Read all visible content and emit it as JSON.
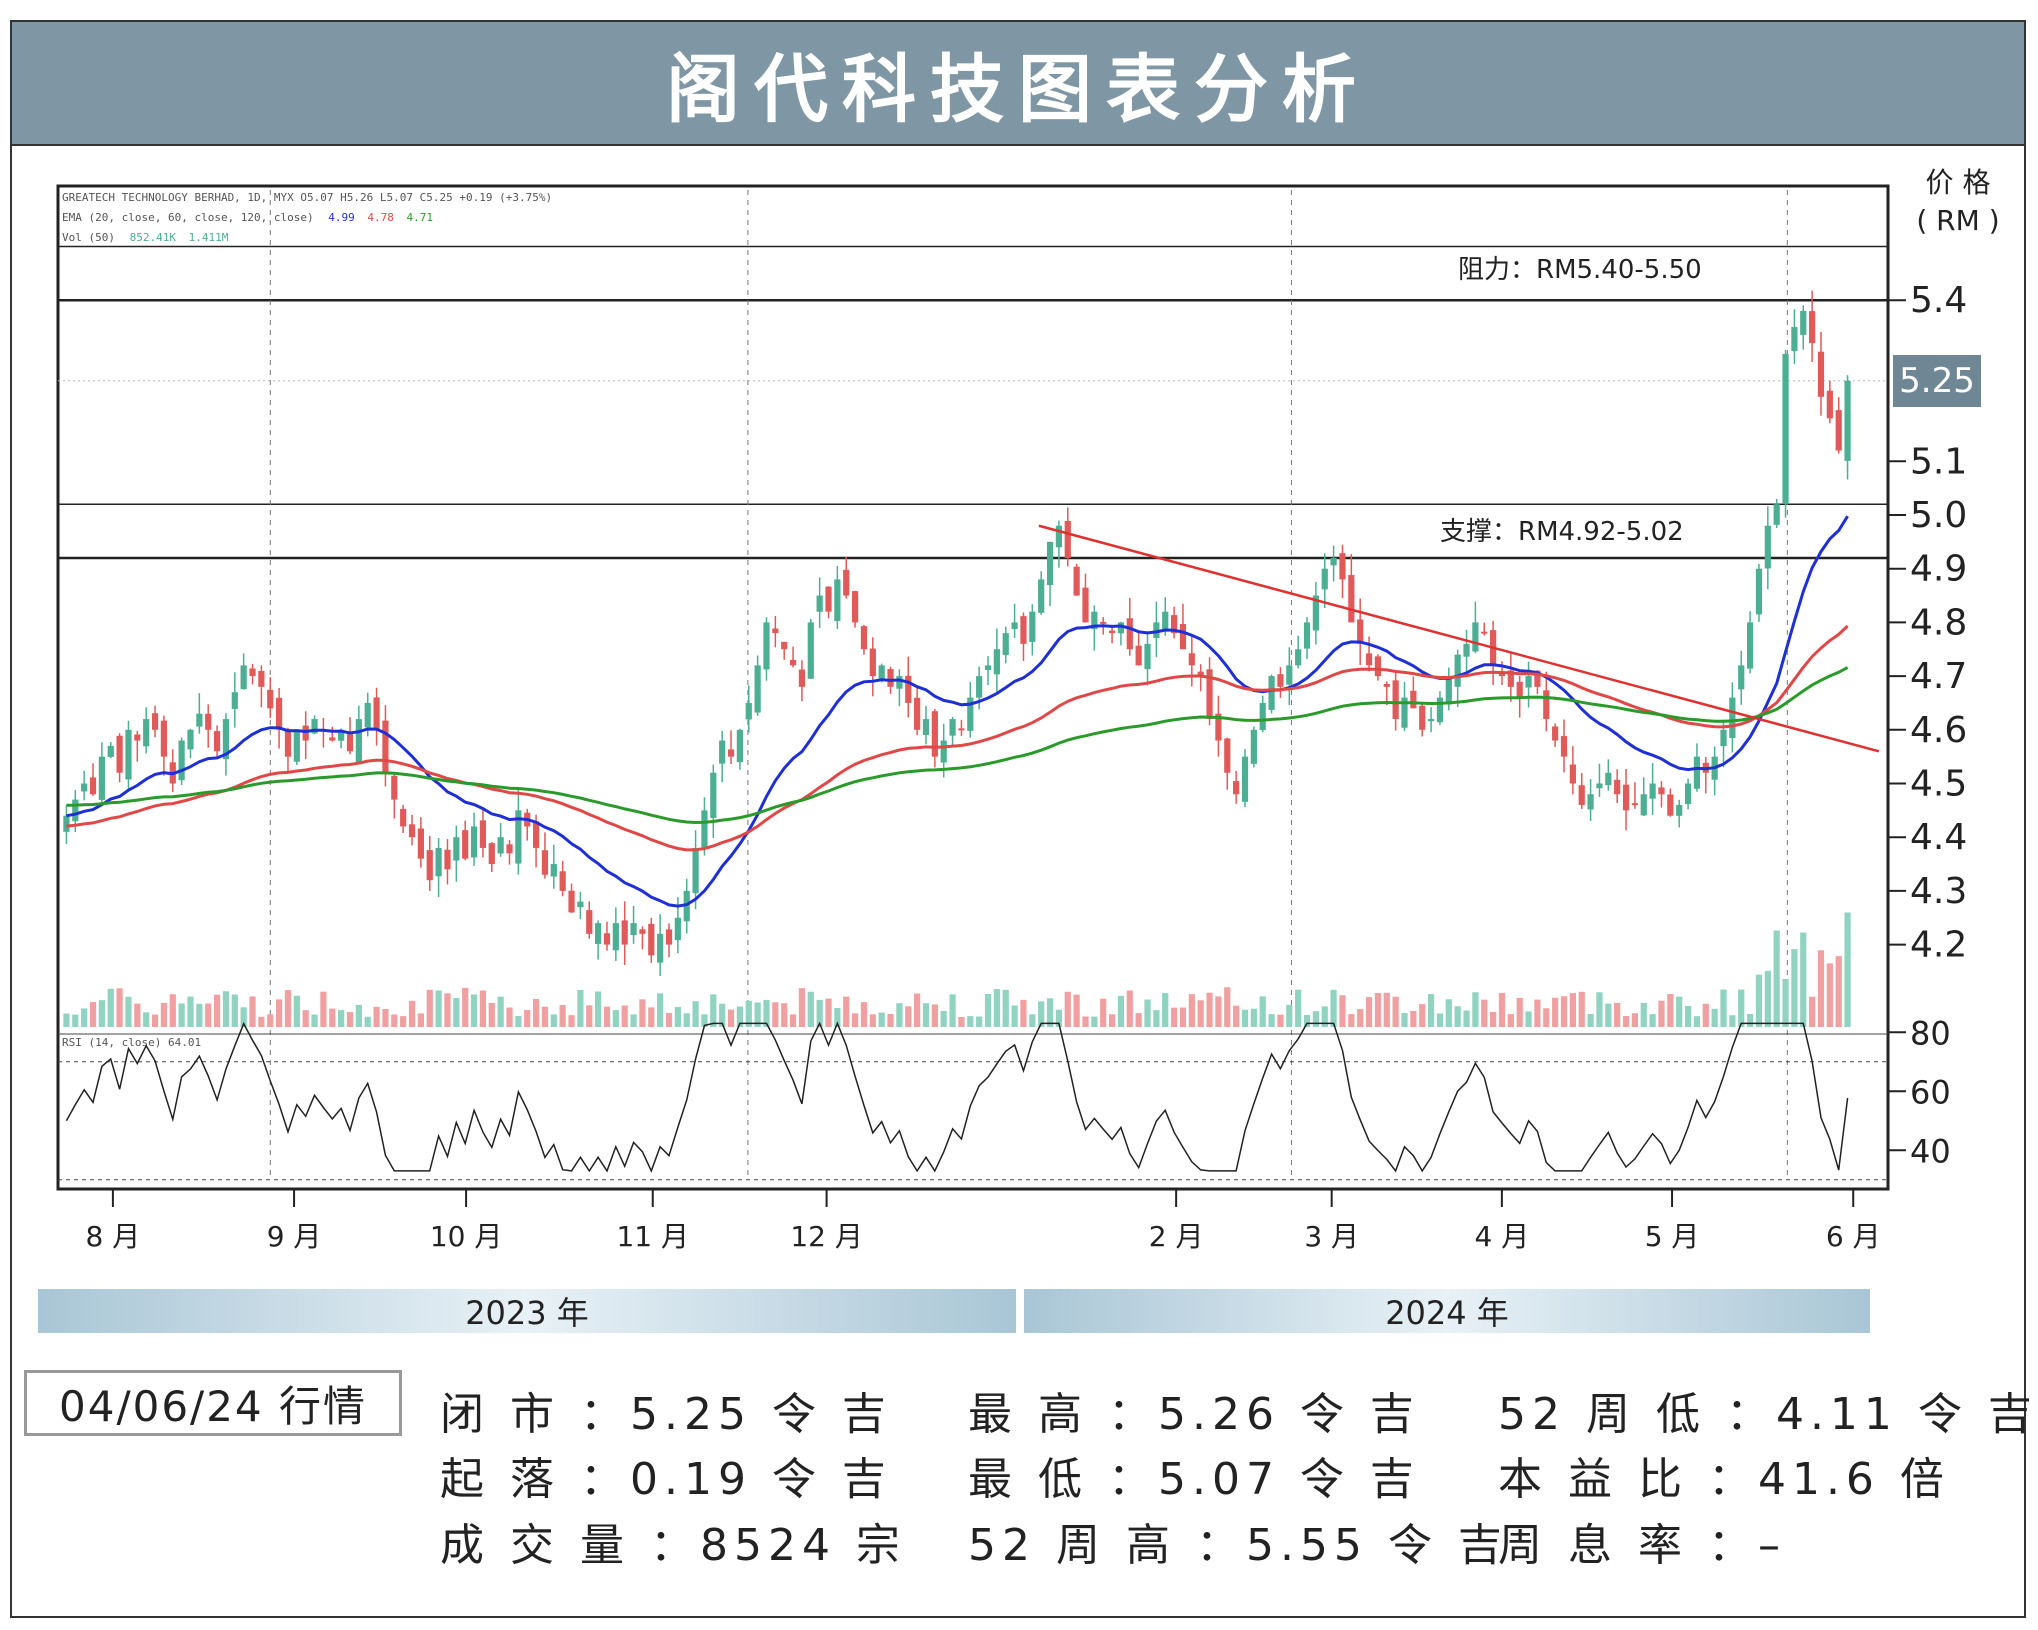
{
  "title": "阁代科技图表分析",
  "unit_label_1": "价 格",
  "unit_label_2": "( RM )",
  "chart_header": {
    "line1": "GREATECH TECHNOLOGY BERHAD, 1D, MYX  O5.07  H5.26  L5.07  C5.25  +0.19 (+3.75%)",
    "line2_prefix": "EMA (20, close, 60, close, 120, close)",
    "ema_values": [
      "4.99",
      "4.78",
      "4.71"
    ],
    "line3_prefix": "Vol (50)",
    "vol_values": [
      "852.41K",
      "1.411M"
    ]
  },
  "rsi_label": "RSI (14, close)  64.01",
  "current_price_tag": "5.25",
  "resistance_label": "阻力：RM5.40-5.50",
  "support_label": "支撑：RM4.92-5.02",
  "y_ticks": [
    "5.4",
    "5.1",
    "5.0",
    "4.9",
    "4.8",
    "4.7",
    "4.6",
    "4.5",
    "4.4",
    "4.3",
    "4.2"
  ],
  "rsi_ticks": [
    "80",
    "60",
    "40"
  ],
  "x_ticks": [
    "8 月",
    "9 月",
    "10 月",
    "11 月",
    "12 月",
    "2 月",
    "3 月",
    "4 月",
    "5 月",
    "6 月"
  ],
  "years": [
    "2023 年",
    "2024 年"
  ],
  "date_box": "04/06/24 行情",
  "stats": {
    "close": "闭 市 ：5.25 令 吉",
    "change": "起 落 ：0.19 令 吉",
    "volume": "成 交 量 ：8524 宗",
    "high": "最 高 ：5.26 令 吉",
    "low": "最 低 ：5.07 令 吉",
    "high52": "52 周 高 ：5.55 令 吉",
    "low52": "52 周 低 ：4.11 令 吉",
    "pe": "本 益 比 ：41.6 倍",
    "dy": "周 息 率 ：–"
  },
  "colors": {
    "up": "#4caf93",
    "down": "#e05a5a",
    "ema20": "#1f2fd6",
    "ema60": "#e04848",
    "ema120": "#2a9a2a",
    "trend": "#e03030",
    "title_bg": "#7f97a5"
  },
  "chart_data": {
    "type": "candlestick",
    "ylim": [
      4.11,
      5.55
    ],
    "rsi_range": [
      30,
      85
    ],
    "resistance": [
      5.4,
      5.5
    ],
    "support": [
      4.92,
      5.02
    ],
    "trendline": {
      "from": [
        0.536,
        4.98
      ],
      "to": [
        0.995,
        4.56
      ]
    },
    "candles_description": "approximate daily OHLC traced from the chart, Jul 2023 - Jun 2024",
    "close_series": [
      4.44,
      4.47,
      4.5,
      4.48,
      4.55,
      4.57,
      4.52,
      4.6,
      4.58,
      4.62,
      4.6,
      4.55,
      4.5,
      4.58,
      4.6,
      4.63,
      4.6,
      4.56,
      4.62,
      4.67,
      4.72,
      4.7,
      4.68,
      4.64,
      4.6,
      4.55,
      4.6,
      4.58,
      4.62,
      4.6,
      4.58,
      4.6,
      4.56,
      4.62,
      4.65,
      4.6,
      4.52,
      4.47,
      4.42,
      4.4,
      4.36,
      4.32,
      4.38,
      4.34,
      4.4,
      4.36,
      4.42,
      4.38,
      4.35,
      4.4,
      4.37,
      4.45,
      4.42,
      4.38,
      4.33,
      4.35,
      4.3,
      4.26,
      4.28,
      4.22,
      4.24,
      4.2,
      4.24,
      4.2,
      4.24,
      4.22,
      4.18,
      4.22,
      4.2,
      4.25,
      4.3,
      4.38,
      4.45,
      4.52,
      4.58,
      4.55,
      4.6,
      4.65,
      4.72,
      4.8,
      4.78,
      4.75,
      4.72,
      4.68,
      4.8,
      4.85,
      4.82,
      4.88,
      4.85,
      4.8,
      4.75,
      4.7,
      4.72,
      4.68,
      4.7,
      4.65,
      4.6,
      4.62,
      4.55,
      4.58,
      4.62,
      4.6,
      4.66,
      4.7,
      4.72,
      4.75,
      4.78,
      4.8,
      4.76,
      4.82,
      4.88,
      4.95,
      4.98,
      4.92,
      4.85,
      4.8,
      4.82,
      4.8,
      4.78,
      4.8,
      4.75,
      4.72,
      4.76,
      4.8,
      4.82,
      4.78,
      4.75,
      4.72,
      4.7,
      4.62,
      4.58,
      4.52,
      4.48,
      4.55,
      4.6,
      4.65,
      4.7,
      4.68,
      4.72,
      4.75,
      4.8,
      4.85,
      4.9,
      4.92,
      4.88,
      4.8,
      4.76,
      4.72,
      4.7,
      4.68,
      4.62,
      4.66,
      4.64,
      4.6,
      4.62,
      4.66,
      4.7,
      4.74,
      4.76,
      4.8,
      4.78,
      4.72,
      4.7,
      4.68,
      4.66,
      4.7,
      4.68,
      4.62,
      4.58,
      4.55,
      4.5,
      4.46,
      4.48,
      4.5,
      4.52,
      4.48,
      4.45,
      4.46,
      4.48,
      4.5,
      4.48,
      4.44,
      4.46,
      4.5,
      4.55,
      4.52,
      4.55,
      4.6,
      4.66,
      4.72,
      4.8,
      4.9,
      4.98,
      5.02,
      5.3,
      5.35,
      5.38,
      5.32,
      5.22,
      5.18,
      5.12,
      5.25
    ],
    "ema20_series": "computed from close_series, period 20",
    "ema60_series": "computed from close_series, period 60",
    "ema120_series": "computed from close_series, period 120"
  }
}
